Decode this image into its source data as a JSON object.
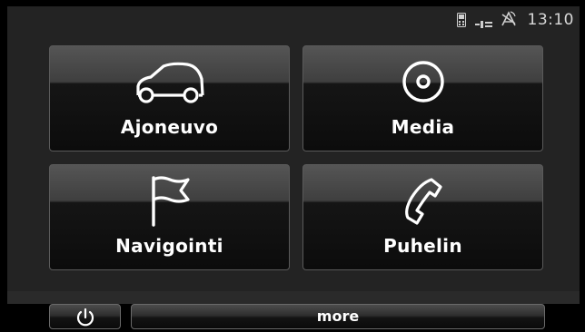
{
  "status": {
    "time": "13:10",
    "icons": [
      "phone-icon",
      "signal-icon",
      "satellite-icon"
    ]
  },
  "tiles": [
    {
      "label": "Ajoneuvo",
      "icon": "car-icon"
    },
    {
      "label": "Media",
      "icon": "disc-icon"
    },
    {
      "label": "Navigointi",
      "icon": "flag-icon"
    },
    {
      "label": "Puhelin",
      "icon": "phone-handset-icon"
    }
  ],
  "bottom": {
    "power_icon": "power-icon",
    "more_label": "more"
  }
}
